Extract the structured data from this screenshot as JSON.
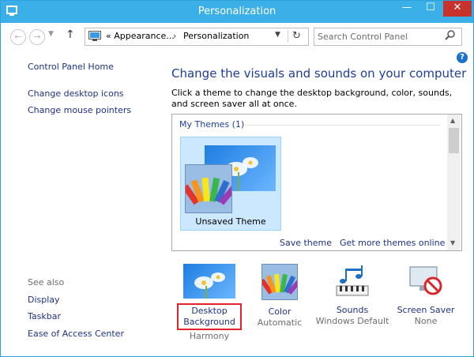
{
  "window": {
    "title": "Personalization"
  },
  "titlebar": {
    "minimize": "—",
    "maximize": "☐",
    "close": "✕"
  },
  "nav": {
    "back": "←",
    "forward": "→",
    "up": "↑"
  },
  "address": {
    "crumb1": "« Appearance...",
    "crumb2": "Personalization"
  },
  "search": {
    "placeholder": "Search Control Panel"
  },
  "help": {
    "label": "?"
  },
  "left": {
    "home": "Control Panel Home",
    "links": [
      "Change desktop icons",
      "Change mouse pointers"
    ],
    "see_also_label": "See also",
    "see_also": [
      "Display",
      "Taskbar",
      "Ease of Access Center"
    ]
  },
  "main": {
    "heading": "Change the visuals and sounds on your computer",
    "description": "Click a theme to change the desktop background, color, sounds, and screen saver all at once.",
    "group": "My Themes (1)",
    "theme_name": "Unsaved Theme",
    "save_theme": "Save theme",
    "get_more": "Get more themes online"
  },
  "items": {
    "desktop": {
      "label": "Desktop Background",
      "sub": "Harmony"
    },
    "color": {
      "label": "Color",
      "sub": "Automatic"
    },
    "sounds": {
      "label": "Sounds",
      "sub": "Windows Default"
    },
    "saver": {
      "label": "Screen Saver",
      "sub": "None"
    }
  },
  "colors": {
    "titlebar": "#3bb0e8",
    "link": "#1e3287",
    "heading": "#1e3e9a",
    "close": "#c7332c",
    "highlight": "#e2232a"
  }
}
